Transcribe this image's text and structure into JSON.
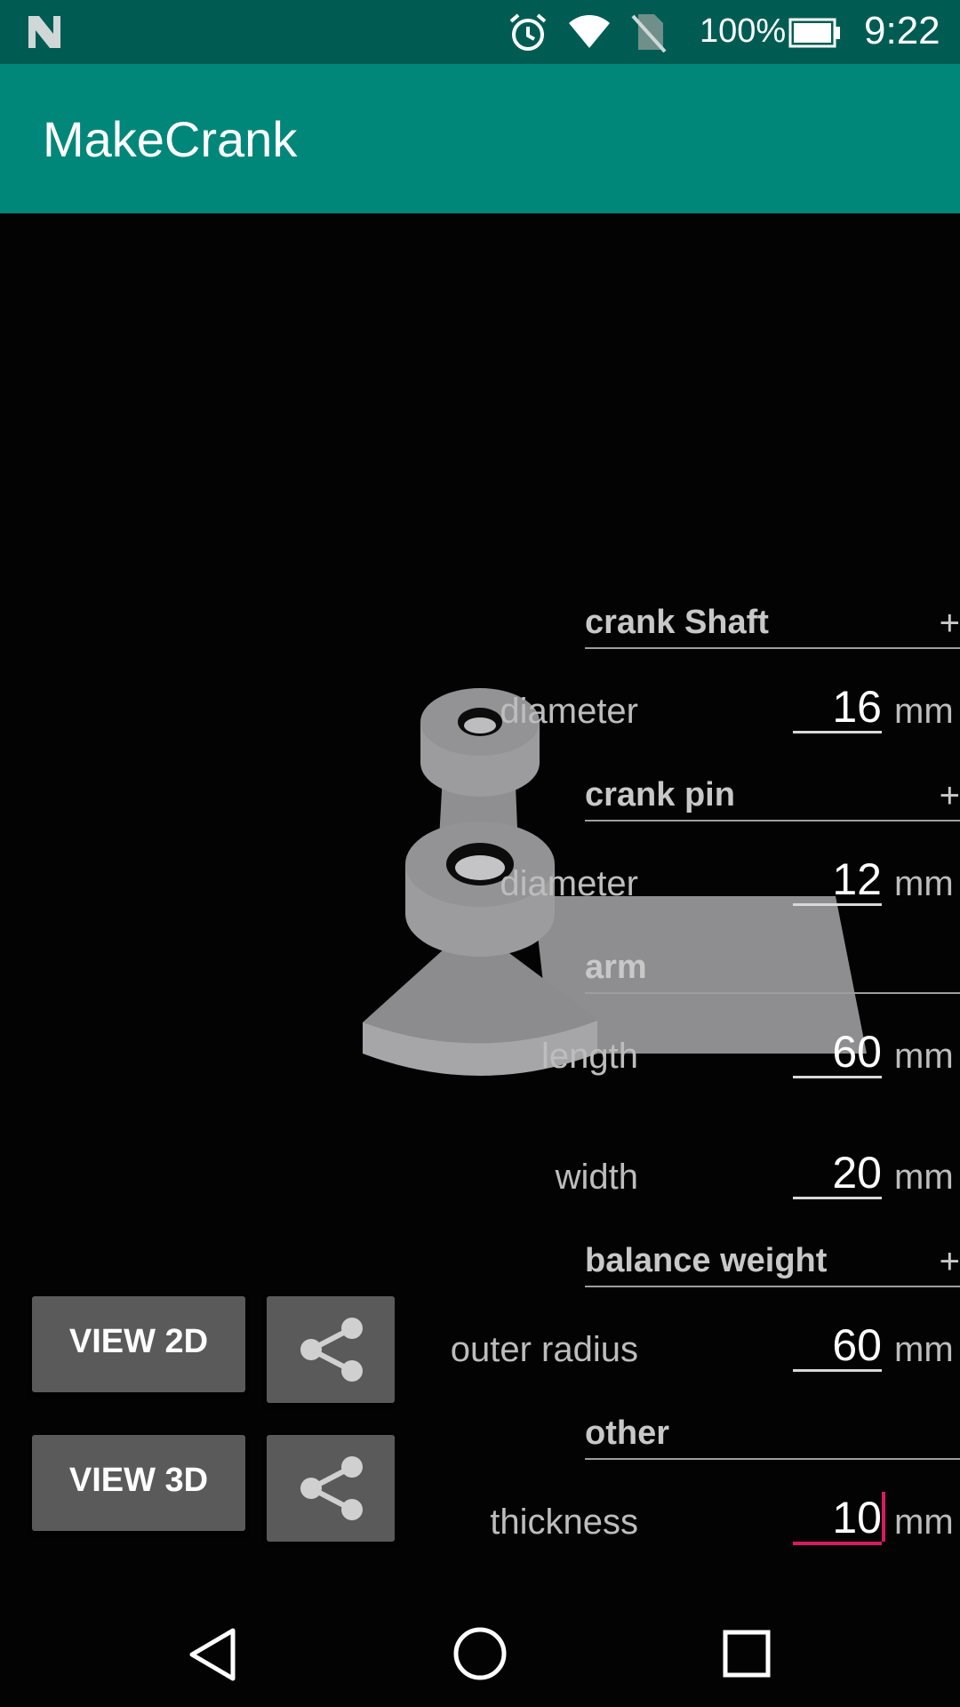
{
  "status_bar": {
    "battery_percent": "100%",
    "time": "9:22",
    "icons": [
      "n-logo-icon",
      "alarm-icon",
      "wifi-icon",
      "no-sim-icon",
      "battery-icon"
    ]
  },
  "app_bar": {
    "title": "MakeCrank"
  },
  "sections": {
    "crank_shaft": {
      "title": "crank Shaft",
      "toggle": "+",
      "diameter": {
        "label": "diameter",
        "value": "16",
        "unit": "mm"
      }
    },
    "crank_pin": {
      "title": "crank pin",
      "toggle": "+",
      "diameter": {
        "label": "diameter",
        "value": "12",
        "unit": "mm"
      }
    },
    "arm": {
      "title": "arm",
      "length": {
        "label": "length",
        "value": "60",
        "unit": "mm"
      },
      "width": {
        "label": "width",
        "value": "20",
        "unit": "mm"
      }
    },
    "balance_weight": {
      "title": "balance weight",
      "toggle": "+",
      "outer_radius": {
        "label": "outer radius",
        "value": "60",
        "unit": "mm"
      }
    },
    "other": {
      "title": "other",
      "thickness": {
        "label": "thickness",
        "value": "10",
        "unit": "mm"
      }
    }
  },
  "buttons": {
    "view_2d": "VIEW 2D",
    "view_3d": "VIEW 3D"
  },
  "colors": {
    "status_bar": "#005c53",
    "app_bar": "#00877a",
    "accent": "#d81b60",
    "button": "#5a5a5a"
  }
}
